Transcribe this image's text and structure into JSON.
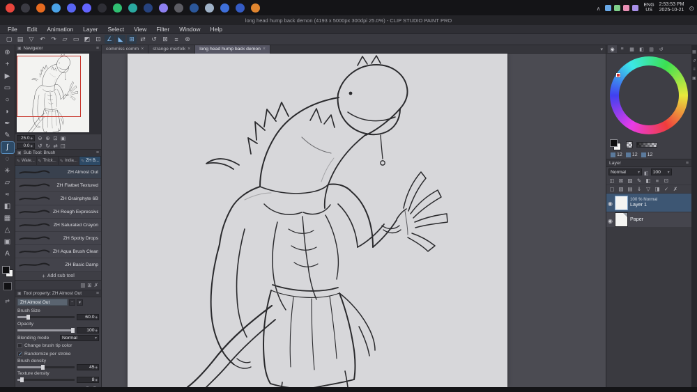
{
  "colors": {
    "accent": "#4f98d8",
    "taskbar": "#141417",
    "titlebar": "#232327",
    "menubar": "#2f2f35",
    "cmdbar": "#3a3a41",
    "panel": "#3e3e45",
    "surround": "#4b4b52",
    "canvas": "#d7d7da",
    "view_rect": "#c8372d"
  },
  "taskbar": {
    "apps": [
      {
        "name": "pokeball-app-icon",
        "color": "#e8453c"
      },
      {
        "name": "dark-app-icon",
        "color": "#3a3a42"
      },
      {
        "name": "firefox-icon",
        "color": "#e66a1f"
      },
      {
        "name": "bluebird-app-icon",
        "color": "#4aa3e8"
      },
      {
        "name": "discord-icon",
        "color": "#5865f2"
      },
      {
        "name": "mastodon-icon",
        "color": "#6364ff"
      },
      {
        "name": "clock-app-icon",
        "color": "#2e2e35"
      },
      {
        "name": "green-app-icon",
        "color": "#2fbf71"
      },
      {
        "name": "teal-app-icon",
        "color": "#2aa8a0"
      },
      {
        "name": "photoshop-icon",
        "color": "#26427e"
      },
      {
        "name": "clip-studio-icon",
        "color": "#8d7ff0"
      },
      {
        "name": "gray-app-icon",
        "color": "#5c5c63"
      },
      {
        "name": "word-icon",
        "color": "#2b579a"
      },
      {
        "name": "files-app-icon",
        "color": "#9fb2c8"
      },
      {
        "name": "blue-app-icon",
        "color": "#3e6fd9"
      },
      {
        "name": "notes-app-icon",
        "color": "#345bc4"
      },
      {
        "name": "compass-app-icon",
        "color": "#e0852f"
      }
    ],
    "tray_icons": [
      {
        "name": "tray-blue-icon",
        "color": "#69a9e8"
      },
      {
        "name": "tray-green-icon",
        "color": "#7fcf8a"
      },
      {
        "name": "tray-pink-icon",
        "color": "#e88fb5"
      },
      {
        "name": "tray-purple-icon",
        "color": "#a88fe8"
      }
    ],
    "time": "2:53:53 PM",
    "date": "2025-10-21",
    "lang": "ENG",
    "region": "US"
  },
  "window_title": "long head hump back demon (4193 x 5000px 300dpi 25.0%) - CLIP STUDIO PAINT PRO",
  "menu": {
    "items": [
      {
        "label": "File"
      },
      {
        "label": "Edit"
      },
      {
        "label": "Animation"
      },
      {
        "label": "Layer"
      },
      {
        "label": "Select"
      },
      {
        "label": "View"
      },
      {
        "label": "Filter"
      },
      {
        "label": "Window"
      },
      {
        "label": "Help"
      }
    ]
  },
  "command_bar": {
    "icons": [
      {
        "name": "new-canvas-icon",
        "glyph": "▢",
        "state": ""
      },
      {
        "name": "open-file-icon",
        "glyph": "▤",
        "state": ""
      },
      {
        "name": "save-icon",
        "glyph": "▽",
        "state": ""
      },
      {
        "name": "undo-icon",
        "glyph": "↶",
        "state": ""
      },
      {
        "name": "redo-icon",
        "glyph": "↷",
        "state": ""
      },
      {
        "name": "clear-icon",
        "glyph": "▱",
        "state": ""
      },
      {
        "name": "deselect-icon",
        "glyph": "▭",
        "state": ""
      },
      {
        "name": "invert-selection-icon",
        "glyph": "◩",
        "state": ""
      },
      {
        "name": "selection-border-icon",
        "glyph": "⊡",
        "state": ""
      },
      {
        "name": "snap-ruler-icon",
        "glyph": "∠",
        "state": "on"
      },
      {
        "name": "snap-special-ruler-icon",
        "glyph": "◣",
        "state": "on"
      },
      {
        "name": "snap-grid-icon",
        "glyph": "⊞",
        "state": "on"
      },
      {
        "name": "flip-canvas-icon",
        "glyph": "⇄",
        "state": ""
      },
      {
        "name": "reset-rotate-icon",
        "glyph": "↺",
        "state": ""
      },
      {
        "name": "fit-screen-icon",
        "glyph": "⊠",
        "state": ""
      },
      {
        "name": "ruler-icon",
        "glyph": "≡",
        "state": ""
      },
      {
        "name": "settings-icon",
        "glyph": "⊛",
        "state": ""
      }
    ]
  },
  "tool_strip": {
    "tools": [
      {
        "name": "zoom-tool-icon",
        "glyph": "⊕",
        "state": ""
      },
      {
        "name": "move-tool-icon",
        "glyph": "+",
        "state": ""
      },
      {
        "name": "operation-tool-icon",
        "glyph": "▶",
        "state": ""
      },
      {
        "name": "marquee-select-tool-icon",
        "glyph": "▭",
        "state": ""
      },
      {
        "name": "lasso-tool-icon",
        "glyph": "○",
        "state": ""
      },
      {
        "name": "eyedropper-tool-icon",
        "glyph": "◗",
        "state": ""
      },
      {
        "name": "pen-tool-icon",
        "glyph": "✒",
        "state": ""
      },
      {
        "name": "pencil-tool-icon",
        "glyph": "✎",
        "state": ""
      },
      {
        "name": "brush-tool-icon",
        "glyph": "∫",
        "state": "selected"
      },
      {
        "name": "airbrush-tool-icon",
        "glyph": "◌",
        "state": ""
      },
      {
        "name": "decoration-tool-icon",
        "glyph": "✳",
        "state": ""
      },
      {
        "name": "eraser-tool-icon",
        "glyph": "▱",
        "state": ""
      },
      {
        "name": "blend-tool-icon",
        "glyph": "≈",
        "state": ""
      },
      {
        "name": "fill-tool-icon",
        "glyph": "◧",
        "state": ""
      },
      {
        "name": "gradient-tool-icon",
        "glyph": "▦",
        "state": ""
      },
      {
        "name": "figure-tool-icon",
        "glyph": "△",
        "state": ""
      },
      {
        "name": "frame-border-tool-icon",
        "glyph": "▣",
        "state": ""
      },
      {
        "name": "text-tool-icon",
        "glyph": "A",
        "state": ""
      }
    ]
  },
  "navigator": {
    "title": "Navigator",
    "zoom": "25.0",
    "rotation": "0.0",
    "row1_icons": [
      {
        "name": "zoom-out-icon",
        "glyph": "⊖"
      },
      {
        "name": "zoom-in-icon",
        "glyph": "⊕"
      },
      {
        "name": "fit-to-screen-icon",
        "glyph": "⊡"
      },
      {
        "name": "actual-size-icon",
        "glyph": "▣"
      }
    ],
    "row2_icons": [
      {
        "name": "rotate-left-icon",
        "glyph": "↺"
      },
      {
        "name": "rotate-right-icon",
        "glyph": "↻"
      },
      {
        "name": "reset-rotation-icon",
        "glyph": "⇄"
      },
      {
        "name": "flip-horizontal-icon",
        "glyph": "◫"
      }
    ]
  },
  "subtool": {
    "title": "Sub Tool: Brush",
    "tabs": [
      {
        "label": "Wate...",
        "state": ""
      },
      {
        "label": "Thick...",
        "state": ""
      },
      {
        "label": "India...",
        "state": ""
      },
      {
        "label": "ZH B...",
        "state": "active"
      }
    ],
    "brushes": [
      {
        "name": "ZH Almost Out",
        "state": "selected"
      },
      {
        "name": "ZH Flatbet Textured",
        "state": ""
      },
      {
        "name": "ZH Grainphyte 6B",
        "state": ""
      },
      {
        "name": "ZH Rough Expressive B",
        "state": ""
      },
      {
        "name": "ZH Saturated Crayon",
        "state": ""
      },
      {
        "name": "ZH Spotty Drops",
        "state": ""
      },
      {
        "name": "ZH Aqua Brush Clean",
        "state": ""
      },
      {
        "name": "ZH Basic Damp",
        "state": ""
      }
    ],
    "add_label": "Add sub tool",
    "foot_icons": [
      {
        "name": "subtool-settings-icon",
        "glyph": "▥"
      },
      {
        "name": "new-subtool-icon",
        "glyph": "⊞"
      },
      {
        "name": "delete-subtool-icon",
        "glyph": "✗"
      }
    ]
  },
  "tool_property": {
    "title": "Tool property: ZH Almost Out",
    "preset": "ZH Almost Out",
    "brush_size": {
      "label": "Brush Size",
      "value": "60.0"
    },
    "opacity": {
      "label": "Opacity",
      "value": "100"
    },
    "blending": {
      "label": "Blending mode",
      "value": "Normal"
    },
    "tip_color": {
      "label": "Change brush tip color"
    },
    "randomize": {
      "label": "Randomize per stroke"
    },
    "density": {
      "label": "Brush density",
      "value": "45"
    },
    "texture": {
      "label": "Texture density",
      "value": "8"
    },
    "foot_icons": [
      {
        "name": "register-preset-icon",
        "glyph": "⊕"
      },
      {
        "name": "advanced-settings-icon",
        "glyph": "⊛"
      }
    ]
  },
  "doc_tabs": [
    {
      "label": "commiss comm",
      "state": ""
    },
    {
      "label": "strange merfolk",
      "state": ""
    },
    {
      "label": "long head hump back demon",
      "state": "active"
    }
  ],
  "palette_icons": [
    {
      "name": "color-wheel-tab-icon",
      "glyph": "◉"
    },
    {
      "name": "color-slider-tab-icon",
      "glyph": "≡"
    },
    {
      "name": "color-set-tab-icon",
      "glyph": "▦"
    },
    {
      "name": "mixing-palette-tab-icon",
      "glyph": "◧"
    },
    {
      "name": "approx-color-tab-icon",
      "glyph": "▥"
    },
    {
      "name": "color-history-tab-icon",
      "glyph": "↺"
    }
  ],
  "color_panel": {
    "values": [
      {
        "name": "red-value",
        "value": "12"
      },
      {
        "name": "green-value",
        "value": "12"
      },
      {
        "name": "blue-value",
        "value": "12"
      }
    ]
  },
  "layer_panel": {
    "title": "Layer",
    "blend_mode": "Normal",
    "opacity": "100",
    "toolbar1": [
      {
        "name": "clip-at-layer-icon",
        "glyph": "◫"
      },
      {
        "name": "lock-layer-icon",
        "glyph": "⊠"
      },
      {
        "name": "lock-alpha-icon",
        "glyph": "▨"
      },
      {
        "name": "set-as-draft-icon",
        "glyph": "✎"
      },
      {
        "name": "enable-mask-icon",
        "glyph": "◧"
      },
      {
        "name": "ruler-range-icon",
        "glyph": "≡"
      },
      {
        "name": "reference-layer-icon",
        "glyph": "⊡"
      }
    ],
    "toolbar2": [
      {
        "name": "new-raster-layer-icon",
        "glyph": "▢"
      },
      {
        "name": "new-vector-layer-icon",
        "glyph": "▧"
      },
      {
        "name": "new-folder-icon",
        "glyph": "▤"
      },
      {
        "name": "transfer-down-icon",
        "glyph": "⇓"
      },
      {
        "name": "merge-down-icon",
        "glyph": "▽"
      },
      {
        "name": "create-mask-icon",
        "glyph": "◨"
      },
      {
        "name": "apply-mask-icon",
        "glyph": "✓"
      },
      {
        "name": "delete-layer-icon",
        "glyph": "✗"
      }
    ],
    "layers": {
      "layer1_info": "100 % Normal",
      "layer1_name": "Layer 1",
      "layer2_name": "Paper"
    }
  },
  "right_strip": {
    "icons": [
      {
        "name": "material-panel-icon",
        "glyph": "▦"
      },
      {
        "name": "history-panel-icon",
        "glyph": "↺"
      },
      {
        "name": "info-panel-icon",
        "glyph": "≡"
      },
      {
        "name": "subview-panel-icon",
        "glyph": "▣"
      }
    ]
  }
}
